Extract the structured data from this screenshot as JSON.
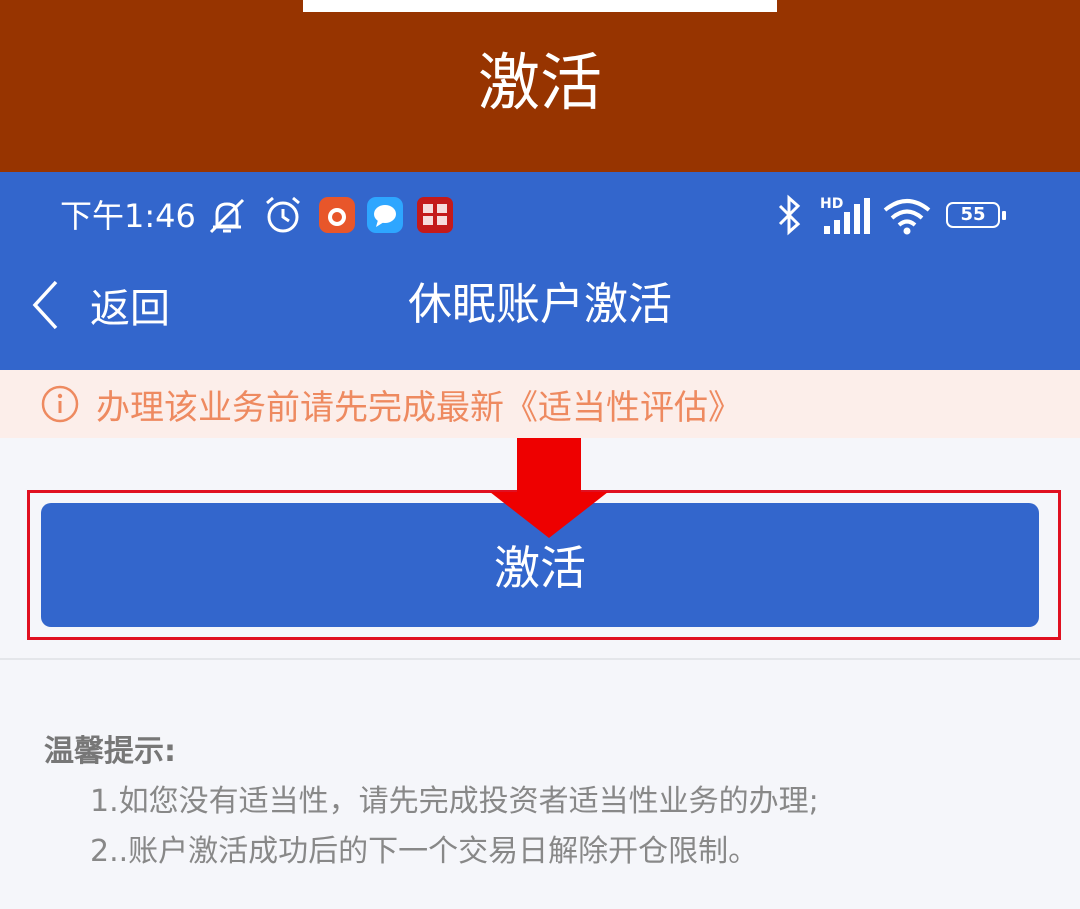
{
  "banner": {
    "title": "激活"
  },
  "status_bar": {
    "time": "下午1:46",
    "battery": "55",
    "network": "HD"
  },
  "nav": {
    "back_label": "返回",
    "title": "休眠账户激活"
  },
  "notice": {
    "text": "办理该业务前请先完成最新《适当性评估》"
  },
  "main": {
    "activate_label": "激活"
  },
  "tips": {
    "title": "温馨提示:",
    "items": [
      "1.如您没有适当性，请先完成投资者适当性业务的办理;",
      "2..账户激活成功后的下一个交易日解除开仓限制。"
    ]
  },
  "colors": {
    "banner_bg": "#973400",
    "primary": "#3366cc",
    "notice_bg": "#fceeea",
    "notice_text": "#ee8a60",
    "highlight": "#e01020"
  },
  "icons": {
    "status": [
      "mute-icon",
      "alarm-icon",
      "app-icon",
      "chat-app-icon",
      "securities-app-icon",
      "bluetooth-icon",
      "signal-icon",
      "wifi-icon",
      "battery-icon"
    ],
    "nav": "chevron-left-icon",
    "notice": "info-icon",
    "annotation": "arrow-down-icon"
  }
}
